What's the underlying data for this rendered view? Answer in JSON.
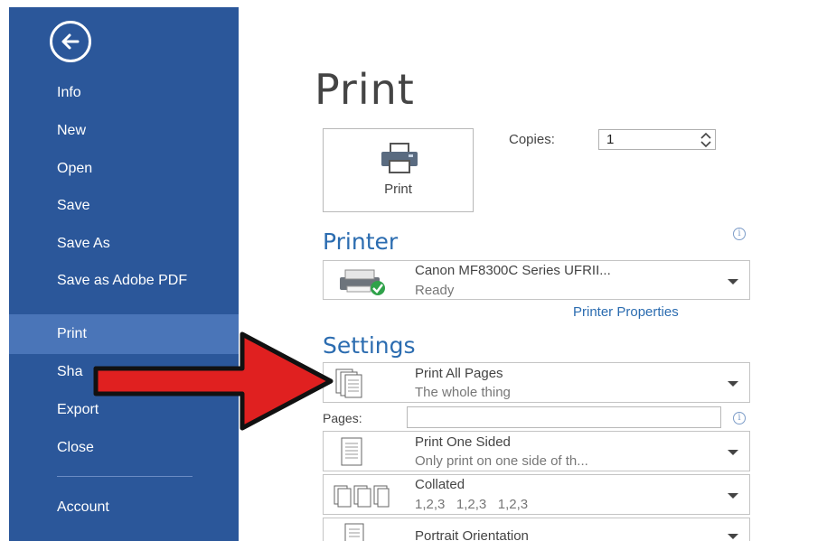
{
  "nav": {
    "items": [
      {
        "label": "Info"
      },
      {
        "label": "New"
      },
      {
        "label": "Open"
      },
      {
        "label": "Save"
      },
      {
        "label": "Save As"
      },
      {
        "label": "Save as Adobe PDF"
      },
      {
        "label": "Print"
      },
      {
        "label": "Sha"
      },
      {
        "label": "Export"
      },
      {
        "label": "Close"
      },
      {
        "label": "Account"
      }
    ],
    "active": "Print"
  },
  "main": {
    "title": "Print",
    "print_button_label": "Print",
    "copies_label": "Copies:",
    "copies_value": "1",
    "printer_heading": "Printer",
    "printer_name": "Canon MF8300C Series UFRII...",
    "printer_status": "Ready",
    "printer_properties_link": "Printer Properties",
    "settings_heading": "Settings",
    "settings": [
      {
        "title": "Print All Pages",
        "subtitle": "The whole thing"
      },
      {
        "title": "Print One Sided",
        "subtitle": "Only print on one side of th..."
      },
      {
        "title": "Collated",
        "subtitle": "1,2,3   1,2,3   1,2,3"
      },
      {
        "title": "Portrait Orientation",
        "subtitle": ""
      }
    ],
    "pages_label": "Pages:",
    "pages_value": ""
  },
  "colors": {
    "sidebar": "#2b579a",
    "sidebar_active": "#4a75b8",
    "accent": "#2b6cb0",
    "annotation_arrow": "#e02020"
  }
}
